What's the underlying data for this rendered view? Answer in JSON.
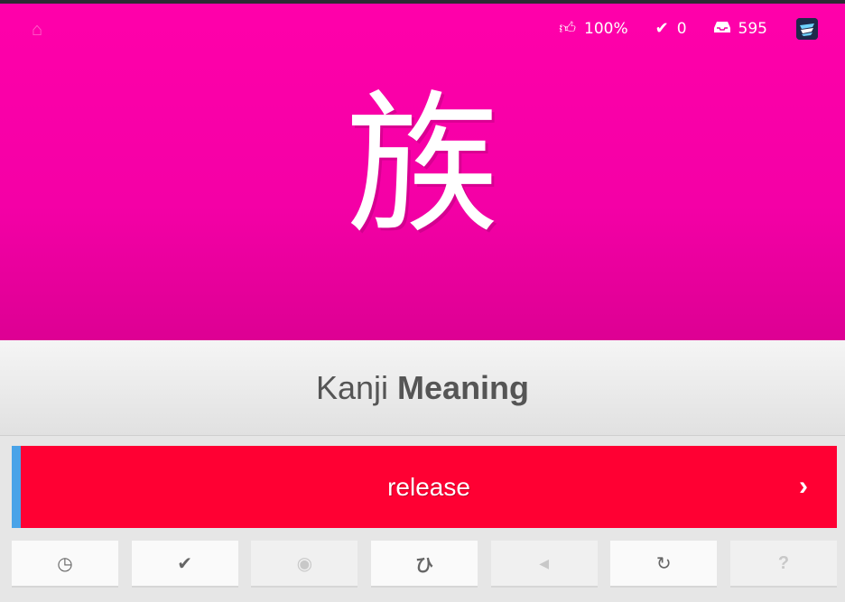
{
  "header": {
    "home_icon": "home-icon",
    "stats": {
      "percent_correct": "100%",
      "completed": "0",
      "remaining": "595"
    }
  },
  "review": {
    "character": "族",
    "question_type_prefix": "Kanji",
    "question_type": "Meaning",
    "answer_value": "release"
  },
  "colors": {
    "kanji_bg": "#ff00aa",
    "answer_incorrect_bg": "#ff0033",
    "answer_accent": "#4aa3e8"
  },
  "action_buttons": [
    {
      "name": "last-items-button",
      "icon": "clock-icon",
      "glyph": "◷",
      "enabled": true
    },
    {
      "name": "item-info-button",
      "icon": "checkmark-icon",
      "glyph": "✔",
      "enabled": true
    },
    {
      "name": "show-answer-button",
      "icon": "eye-icon",
      "glyph": "◉",
      "enabled": false
    },
    {
      "name": "hiragana-button",
      "icon": "hiragana-icon",
      "glyph": "ひ",
      "enabled": true
    },
    {
      "name": "audio-button",
      "icon": "speaker-icon",
      "glyph": "◀",
      "enabled": false
    },
    {
      "name": "retry-button",
      "icon": "retry-icon",
      "glyph": "↻",
      "enabled": true
    },
    {
      "name": "help-button",
      "icon": "question-icon",
      "glyph": "?",
      "enabled": false
    }
  ]
}
